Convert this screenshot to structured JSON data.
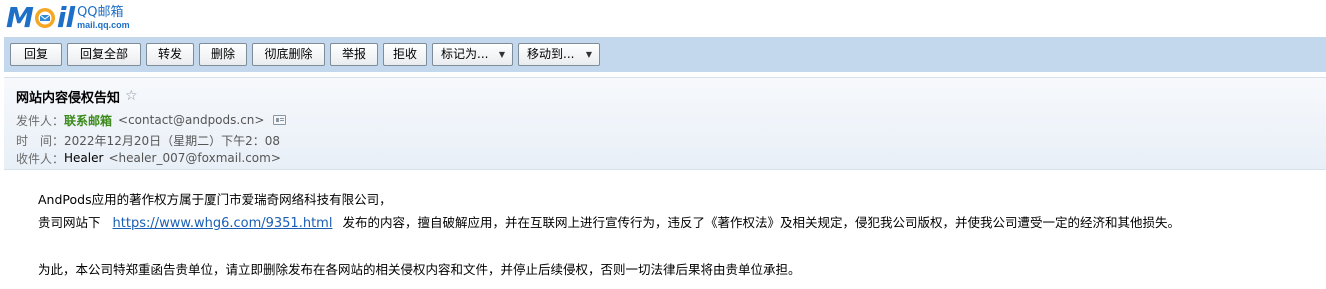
{
  "logo": {
    "letters_start": "M",
    "letters_end": "il",
    "product_name": "QQ邮箱",
    "domain": "mail.qq.com",
    "brand_color": "#1d6fc7",
    "icon": "envelope-o-icon"
  },
  "toolbar": {
    "buttons": [
      {
        "label": "回复"
      },
      {
        "label": "回复全部"
      },
      {
        "label": "转发"
      },
      {
        "label": "删除"
      },
      {
        "label": "彻底删除"
      },
      {
        "label": "举报"
      },
      {
        "label": "拒收"
      },
      {
        "label": "标记为..."
      },
      {
        "label": "移动到..."
      }
    ],
    "dropdown_caret": "▼",
    "background": "#c4d8ed"
  },
  "mail": {
    "subject": "网站内容侵权告知",
    "star_icon": "☆",
    "from_label": "发件人：",
    "from_name": "联系邮箱",
    "from_address": "<contact@andpods.cn>",
    "time_label": "时　间：",
    "time_value": "2022年12月20日（星期二）下午2：08",
    "to_label": "收件人：",
    "to_name": "Healer",
    "to_address": "<healer_007@foxmail.com>"
  },
  "body": {
    "line1": "AndPods应用的著作权方属于厦门市爱瑞奇网络科技有限公司，",
    "line2_prefix": "贵司网站下",
    "line2_link": "https://www.whg6.com/9351.html",
    "line2_suffix": "发布的内容，擅自破解应用，并在互联网上进行宣传行为，违反了《著作权法》及相关规定，侵犯我公司版权，并使我公司遭受一定的经济和其他损失。",
    "line3": "为此，本公司特郑重函告贵单位，请立即删除发布在各网站的相关侵权内容和文件，并停止后续侵权，否则一切法律后果将由贵单位承担。"
  }
}
